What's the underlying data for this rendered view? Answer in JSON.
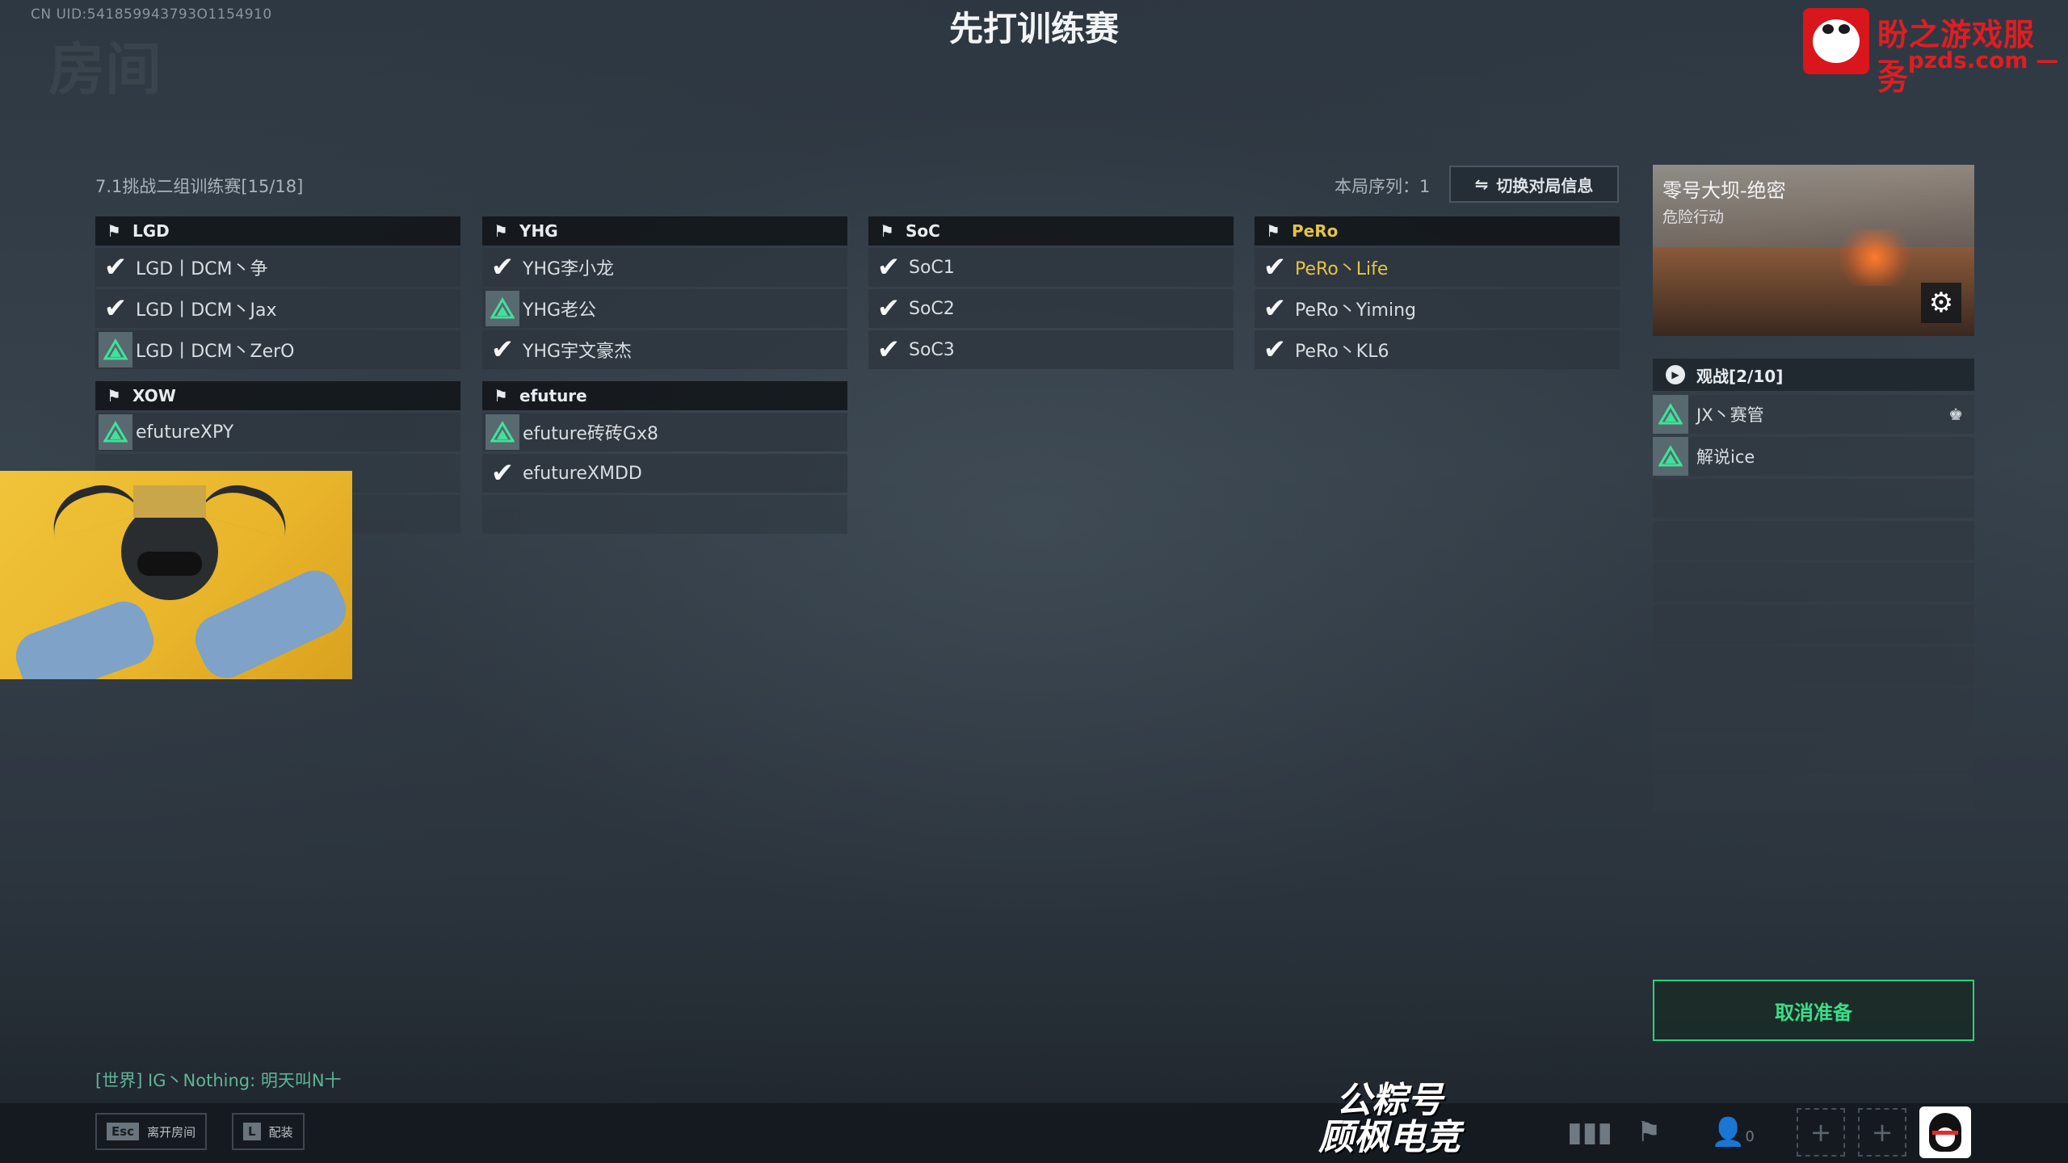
{
  "uid": "CN UID:541859943793O1154910",
  "background_word": "房间",
  "title": "先打训练赛",
  "brand": {
    "name": "盼之游戏服务",
    "site": "— pzds.com —"
  },
  "room": {
    "name": "7.1挑战二组训练赛[15/18]",
    "sequence_label": "本局序列：1",
    "switch_label": "切换对局信息"
  },
  "teams": [
    {
      "name": "LGD",
      "players": [
        {
          "name": "LGD丨DCM丶争",
          "status": "ready"
        },
        {
          "name": "LGD丨DCM丶Jax",
          "status": "ready"
        },
        {
          "name": "LGD丨DCM丶ZerO",
          "status": "not-ready"
        }
      ]
    },
    {
      "name": "YHG",
      "players": [
        {
          "name": "YHG李小龙",
          "status": "ready"
        },
        {
          "name": "YHG老公",
          "status": "not-ready"
        },
        {
          "name": "YHG宇文豪杰",
          "status": "ready"
        }
      ]
    },
    {
      "name": "SoC",
      "players": [
        {
          "name": "SoC1",
          "status": "ready"
        },
        {
          "name": "SoC2",
          "status": "ready"
        },
        {
          "name": "SoC3",
          "status": "ready"
        }
      ]
    },
    {
      "name": "PeRo",
      "highlight": true,
      "players": [
        {
          "name": "PeRo丶Life",
          "status": "ready",
          "highlight": true
        },
        {
          "name": "PeRo丶Yiming",
          "status": "ready"
        },
        {
          "name": "PeRo丶KL6",
          "status": "ready"
        }
      ]
    },
    {
      "name": "XOW",
      "players": [
        {
          "name": "efutureXPY",
          "status": "not-ready"
        }
      ]
    },
    {
      "name": "efuture",
      "players": [
        {
          "name": "efuture砖砖Gx8",
          "status": "not-ready"
        },
        {
          "name": "efutureXMDD",
          "status": "ready"
        }
      ]
    }
  ],
  "map": {
    "name": "零号大坝-绝密",
    "mode": "危险行动"
  },
  "spectate": {
    "title": "观战[2/10]",
    "players": [
      {
        "name": "JX丶赛管",
        "owner": true
      },
      {
        "name": "解说ice",
        "owner": false
      }
    ]
  },
  "ready_button": "取消准备",
  "chat": "[世界] IG丶Nothing: 明天叫N十",
  "bottom": {
    "esc_key": "Esc",
    "esc_label": "离开房间",
    "l_key": "L",
    "l_label": "配装",
    "friends_count": "0"
  },
  "watermark": {
    "line1": "公粽号",
    "line2": "顾枫电竞"
  },
  "colors": {
    "accent_green": "#2bd27a",
    "highlight_gold": "#e3c34a"
  },
  "icons": {
    "ready": "check-icon",
    "not_ready": "triangle-icon",
    "flag": "flag-icon",
    "settings": "gear-icon"
  }
}
